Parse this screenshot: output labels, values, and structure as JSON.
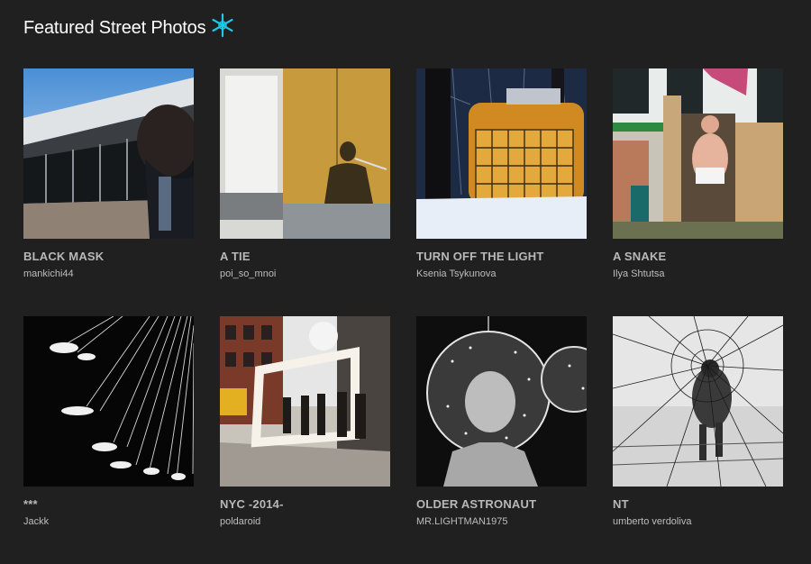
{
  "header": {
    "title": "Featured Street Photos",
    "logo_icon": "snowflake-asterisk-icon",
    "accent_color": "#1ec8e6"
  },
  "photos": [
    {
      "title": "BLACK MASK",
      "author": "mankichi44"
    },
    {
      "title": "A TIE",
      "author": "poi_so_mnoi"
    },
    {
      "title": "TURN OFF THE LIGHT",
      "author": "Ksenia Tsykunova"
    },
    {
      "title": "A SNAKE",
      "author": "Ilya Shtutsa"
    },
    {
      "title": "***",
      "author": "Jackk"
    },
    {
      "title": "NYC -2014-",
      "author": "poldaroid"
    },
    {
      "title": "OLDER ASTRONAUT",
      "author": "MR.LIGHTMAN1975"
    },
    {
      "title": "NT",
      "author": "umberto verdoliva"
    }
  ]
}
